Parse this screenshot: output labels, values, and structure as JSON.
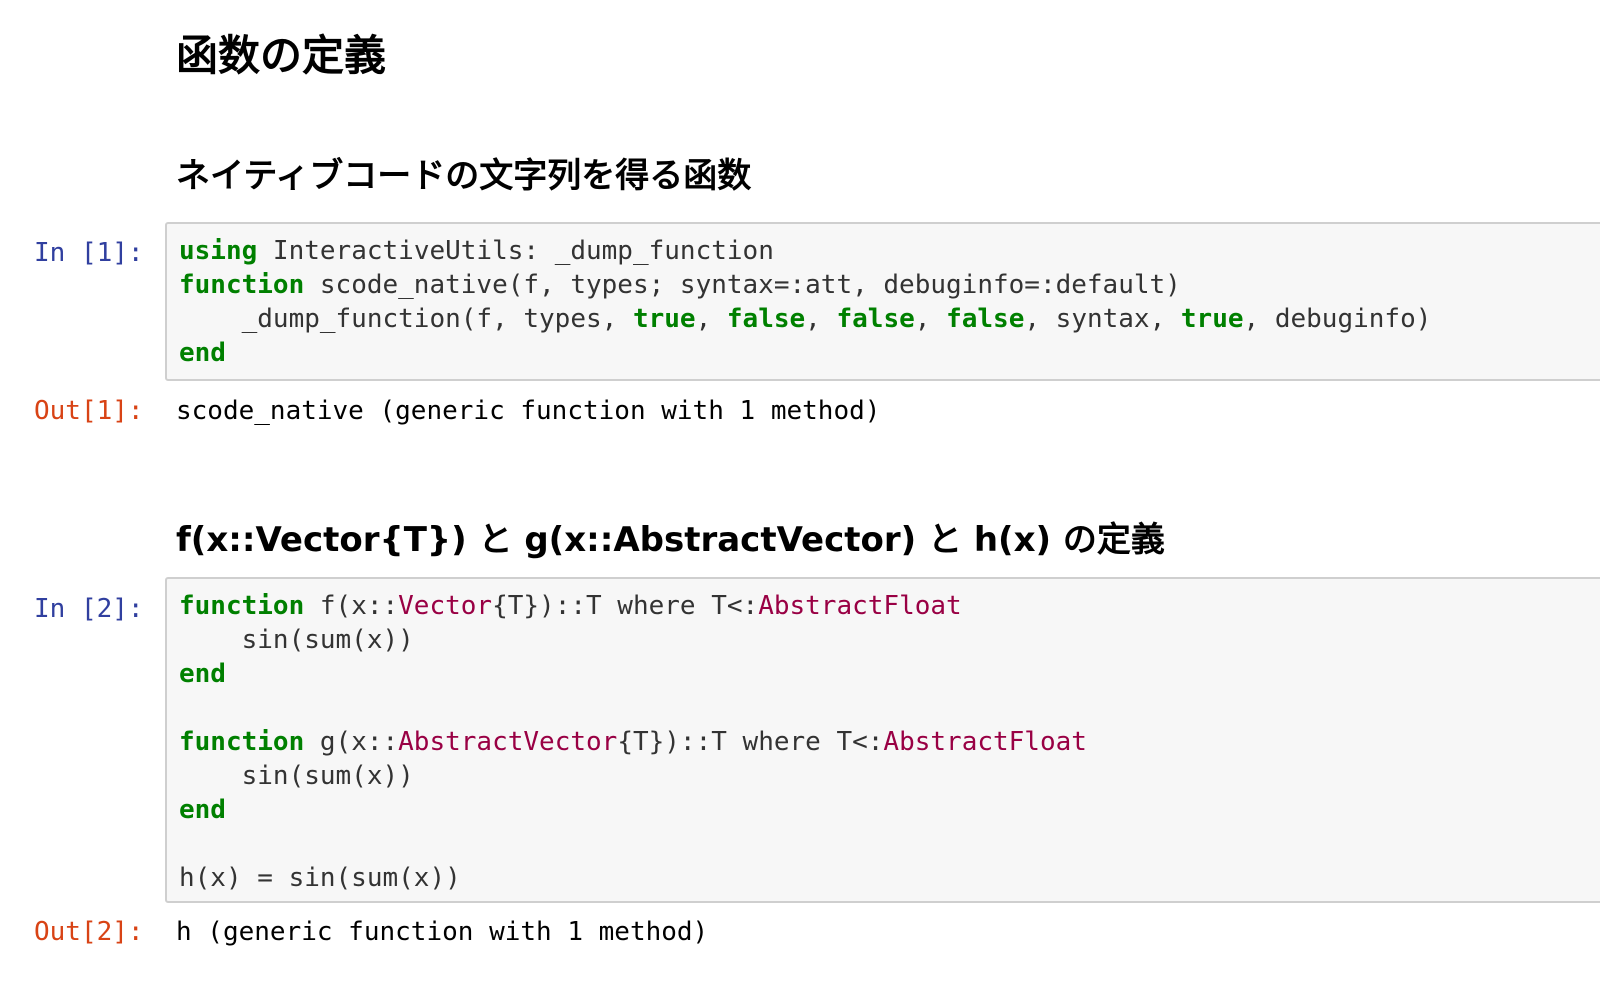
{
  "headings": {
    "main": "函数の定義",
    "section1": "ネイティブコードの文字列を得る函数",
    "section2": "f(x::Vector{T}) と g(x::AbstractVector) と h(x) の定義"
  },
  "cells": [
    {
      "in_prompt": "In [1]:",
      "out_prompt": "Out[1]:",
      "output": "scode_native (generic function with 1 method)",
      "code": {
        "l1_kw": "using",
        "l1_rest": " InteractiveUtils: _dump_function",
        "l2_kw": "function",
        "l2_rest": " scode_native(f, types; syntax=:att, debuginfo=:default)",
        "l3_a": "    _dump_function(f, types, ",
        "l3_true1": "true",
        "l3_c1": ", ",
        "l3_false1": "false",
        "l3_c2": ", ",
        "l3_false2": "false",
        "l3_c3": ", ",
        "l3_false3": "false",
        "l3_b": ", syntax, ",
        "l3_true2": "true",
        "l3_c": ", debuginfo)",
        "l4_kw": "end"
      }
    },
    {
      "in_prompt": "In [2]:",
      "out_prompt": "Out[2]:",
      "output": "h (generic function with 1 method)",
      "code": {
        "f_kw": "function",
        "f_a": " f(x::",
        "f_ty1": "Vector",
        "f_b": "{T})::T where T<:",
        "f_ty2": "AbstractFloat",
        "f_body": "    sin(sum(x))",
        "f_end": "end",
        "g_kw": "function",
        "g_a": " g(x::",
        "g_ty1": "AbstractVector",
        "g_b": "{T})::T where T<:",
        "g_ty2": "AbstractFloat",
        "g_body": "    sin(sum(x))",
        "g_end": "end",
        "h_line": "h(x) = sin(sum(x))"
      }
    }
  ],
  "colors": {
    "keyword": "#008000",
    "type": "#990044",
    "in_prompt": "#303F9F",
    "out_prompt": "#D84315",
    "cell_background": "#f7f7f7"
  }
}
